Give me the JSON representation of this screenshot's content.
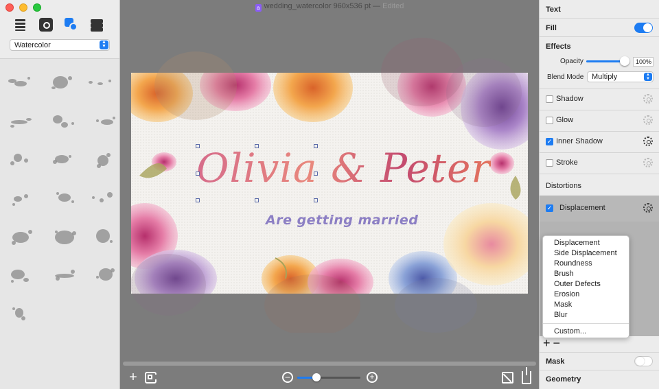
{
  "window": {
    "title": "wedding_watercolor 960x536 pt",
    "status": "Edited"
  },
  "left_panel": {
    "brush_set": "Watercolor",
    "brush_count": 19
  },
  "canvas": {
    "headline": "Olivia & Peter",
    "subline": "Are getting married",
    "zoom_fraction": 0.3
  },
  "inspector": {
    "text_title": "Text",
    "fill_title": "Fill",
    "fill_on": true,
    "effects_title": "Effects",
    "opacity_label": "Opacity",
    "opacity_value": "100%",
    "blend_label": "Blend Mode",
    "blend_value": "Multiply",
    "effects": [
      {
        "label": "Shadow",
        "checked": false
      },
      {
        "label": "Glow",
        "checked": false
      },
      {
        "label": "Inner Shadow",
        "checked": true
      },
      {
        "label": "Stroke",
        "checked": false
      }
    ],
    "distortions_title": "Distortions",
    "displacement_label": "Displacement",
    "displacement_checked": true,
    "menu_items": [
      "Displacement",
      "Side Displacement",
      "Roundness",
      "Brush",
      "Outer Defects",
      "Erosion",
      "Mask",
      "Blur"
    ],
    "menu_custom": "Custom...",
    "mask_title": "Mask",
    "mask_on": false,
    "geometry_title": "Geometry"
  },
  "colors": {
    "accent": "#1d7cf2",
    "headline_pink": "#d35c77",
    "subline_purple": "#8c7fc4"
  }
}
